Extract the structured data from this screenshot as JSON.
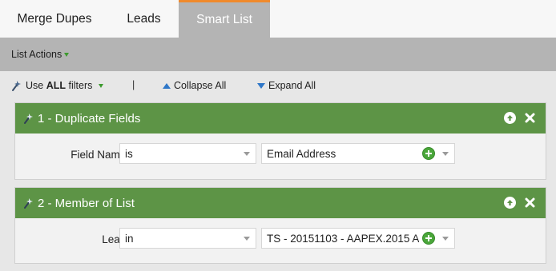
{
  "tabs": [
    {
      "label": "Merge Dupes",
      "active": false
    },
    {
      "label": "Leads",
      "active": false
    },
    {
      "label": "Smart List",
      "active": true
    }
  ],
  "colors": {
    "active_tab_accent": "#f08a2c",
    "filter_header": "#5d9446",
    "add_button": "#4aa63a",
    "link_blue": "#2f77c8"
  },
  "list_actions": {
    "label": "List Actions",
    "icon": "caret-down-green-icon"
  },
  "filter_toolbar": {
    "use_prefix": "Use ",
    "use_bold": "ALL",
    "use_suffix": " filters",
    "separator": "|",
    "collapse_label": "Collapse All",
    "expand_label": "Expand All"
  },
  "filters": [
    {
      "title": "1 - Duplicate Fields",
      "field_label": "Field Name:",
      "operator": "is",
      "value": "Email Address"
    },
    {
      "title": "2 - Member of List",
      "field_label": "Lead:",
      "operator": "in",
      "value": "TS - 20151103 - AAPEX.2015 A"
    }
  ]
}
